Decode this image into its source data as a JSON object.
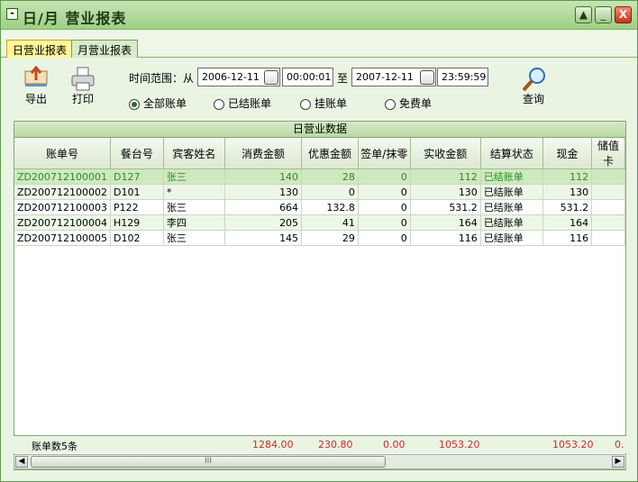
{
  "window": {
    "title": "日/月  营业报表",
    "controls": [
      "▲",
      "_",
      "X"
    ]
  },
  "tabs": [
    {
      "label": "日营业报表",
      "active": true
    },
    {
      "label": "月营业报表",
      "active": false
    }
  ],
  "toolbar": {
    "export_label": "导出",
    "print_label": "打印",
    "query_label": "查询"
  },
  "filter": {
    "range_label": "时间范围：从",
    "to_label": "至",
    "start_date": "2006-12-11",
    "start_time": "00:00:01",
    "end_date": "2007-12-11",
    "end_time": "23:59:59",
    "radios": [
      {
        "label": "全部账单",
        "checked": true
      },
      {
        "label": "已结账单",
        "checked": false
      },
      {
        "label": "挂账单",
        "checked": false
      },
      {
        "label": "免费单",
        "checked": false
      }
    ]
  },
  "grid": {
    "caption": "日营业数据",
    "columns": [
      "账单号",
      "餐台号",
      "宾客姓名",
      "消费金额",
      "优惠金额",
      "签单/抹零",
      "实收金额",
      "结算状态",
      "现金",
      "储值卡"
    ],
    "rows": [
      [
        "ZD200712100001",
        "D127",
        "张三",
        "140",
        "28",
        "0",
        "112",
        "已结账单",
        "112",
        ""
      ],
      [
        "ZD200712100002",
        "D101",
        "*",
        "130",
        "0",
        "0",
        "130",
        "已结账单",
        "130",
        ""
      ],
      [
        "ZD200712100003",
        "P122",
        "张三",
        "664",
        "132.8",
        "0",
        "531.2",
        "已结账单",
        "531.2",
        ""
      ],
      [
        "ZD200712100004",
        "H129",
        "李四",
        "205",
        "41",
        "0",
        "164",
        "已结账单",
        "164",
        ""
      ],
      [
        "ZD200712100005",
        "D102",
        "张三",
        "145",
        "29",
        "0",
        "116",
        "已结账单",
        "116",
        ""
      ]
    ]
  },
  "footer": {
    "count_label": "账单数5条",
    "consume_total": "1284.00",
    "discount_total": "230.80",
    "sign_total": "0.00",
    "received_total": "1053.20",
    "cash_total": "1053.20",
    "card_total": "0."
  },
  "scrollbar": {
    "thumb_grip": "III"
  },
  "colors": {
    "accent_green": "#2a8d22",
    "total_red": "#c82c2c",
    "active_tab": "#fff59a"
  }
}
